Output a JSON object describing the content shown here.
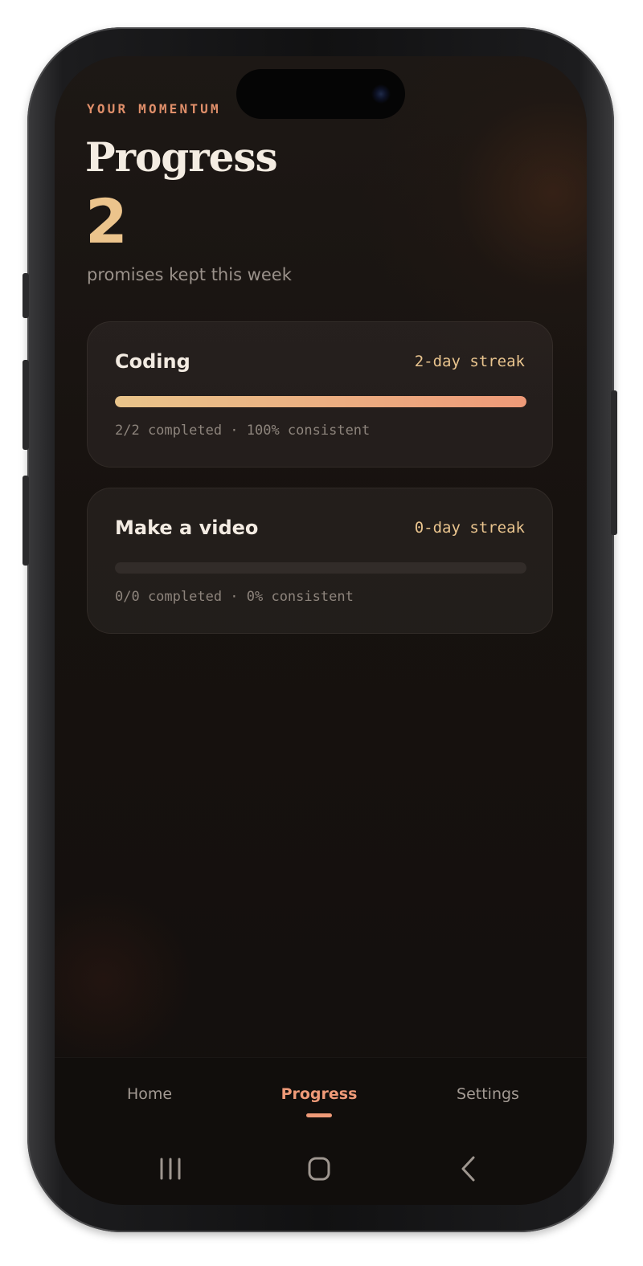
{
  "header": {
    "eyebrow": "YOUR MOMENTUM",
    "title": "Progress",
    "count": "2",
    "count_caption": "promises kept this week"
  },
  "habits": [
    {
      "name": "Coding",
      "streak": "2-day streak",
      "meta": "2/2 completed · 100% consistent",
      "progress": 1.0
    },
    {
      "name": "Make a video",
      "streak": "0-day streak",
      "meta": "0/0 completed · 0% consistent",
      "progress": 0.0
    }
  ],
  "tabs": [
    {
      "label": "Home",
      "active": false
    },
    {
      "label": "Progress",
      "active": true
    },
    {
      "label": "Settings",
      "active": false
    }
  ],
  "system_nav": {
    "recents": "recents-icon",
    "home": "home-icon",
    "back": "back-icon"
  },
  "colors": {
    "accent": "#ef9a78",
    "streak": "#e9c48e",
    "count": "#ecc48c",
    "background": "#17120f"
  }
}
